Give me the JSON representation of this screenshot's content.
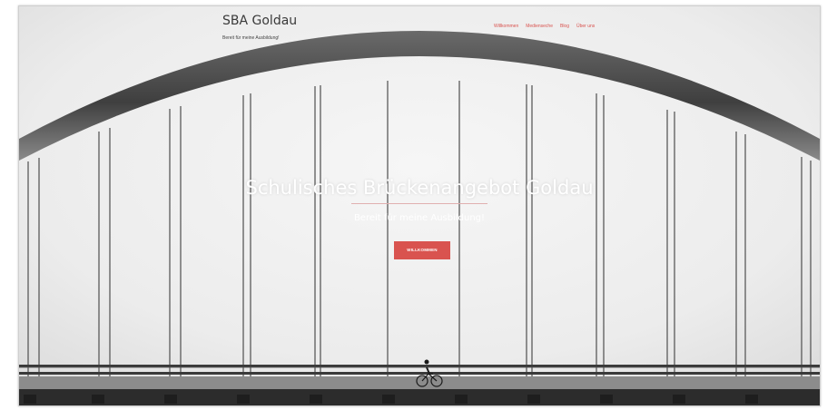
{
  "site": {
    "title": "SBA Goldau",
    "tagline": "Bereit für meine Ausbildung!"
  },
  "nav": {
    "items": [
      {
        "label": "Willkommen"
      },
      {
        "label": "Medienseche"
      },
      {
        "label": "Blog"
      },
      {
        "label": "Über uns"
      }
    ]
  },
  "hero": {
    "title": "Schulisches Brückenangebot Goldau",
    "subtitle": "Bereit für meine Ausbildung!",
    "button_label": "WILLKOMMEN"
  },
  "colors": {
    "accent": "#d9534f",
    "title_text": "#3a3a3a",
    "hero_text": "#ffffff",
    "background": "#efefef"
  }
}
